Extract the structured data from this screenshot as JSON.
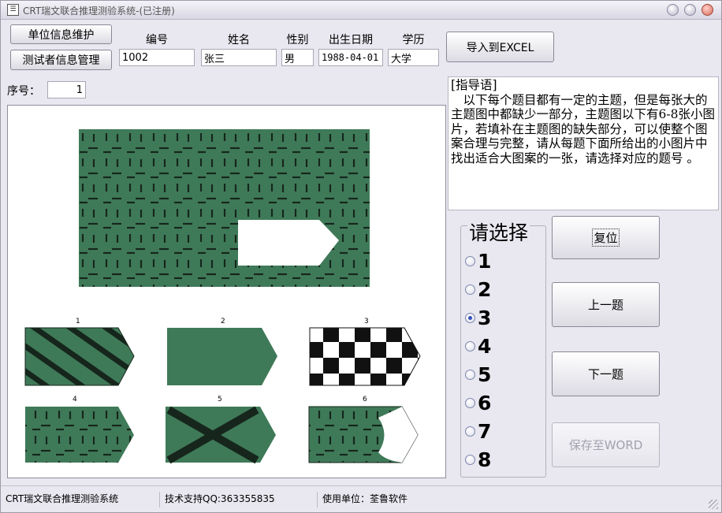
{
  "window": {
    "title": "CRT瑞文联合推理测验系统-(已注册)",
    "icon_glyph": "☰"
  },
  "toolbar": {
    "unit_info_label": "单位信息维护",
    "tester_info_label": "测试者信息管理",
    "export_label": "导入到EXCEL"
  },
  "fields": {
    "id_label": "编号",
    "id_value": "1002",
    "name_label": "姓名",
    "name_value": "张三",
    "gender_label": "性别",
    "gender_value": "男",
    "birth_label": "出生日期",
    "birth_value": "1988-04-01",
    "edu_label": "学历",
    "edu_value": "大学"
  },
  "seq": {
    "label": "序号：",
    "value": "1"
  },
  "puzzle": {
    "option_numbers": [
      "1",
      "2",
      "3",
      "4",
      "5",
      "6"
    ],
    "colors": {
      "green": "#3f7a58",
      "mark": "#16261c"
    }
  },
  "guide": {
    "heading": "[指导语]",
    "body": "以下每个题目都有一定的主题，但是每张大的主题图中都缺少一部分，主题图以下有6-8张小图片，若填补在主题图的缺失部分，可以使整个图案合理与完整，请从每题下面所给出的小图片中找出适合大图案的一张，请选择对应的题号 。"
  },
  "choose": {
    "title": "请选择",
    "options": [
      "1",
      "2",
      "3",
      "4",
      "5",
      "6",
      "7",
      "8"
    ],
    "selected": "3"
  },
  "actions": {
    "reset_label": "复位",
    "prev_label": "上一题",
    "next_label": "下一题",
    "save_label": "保存至WORD"
  },
  "status": {
    "app_name": "CRT瑞文联合推理测验系统",
    "support": "技术支持QQ:363355835",
    "user_unit": "使用单位：荃鲁软件"
  }
}
